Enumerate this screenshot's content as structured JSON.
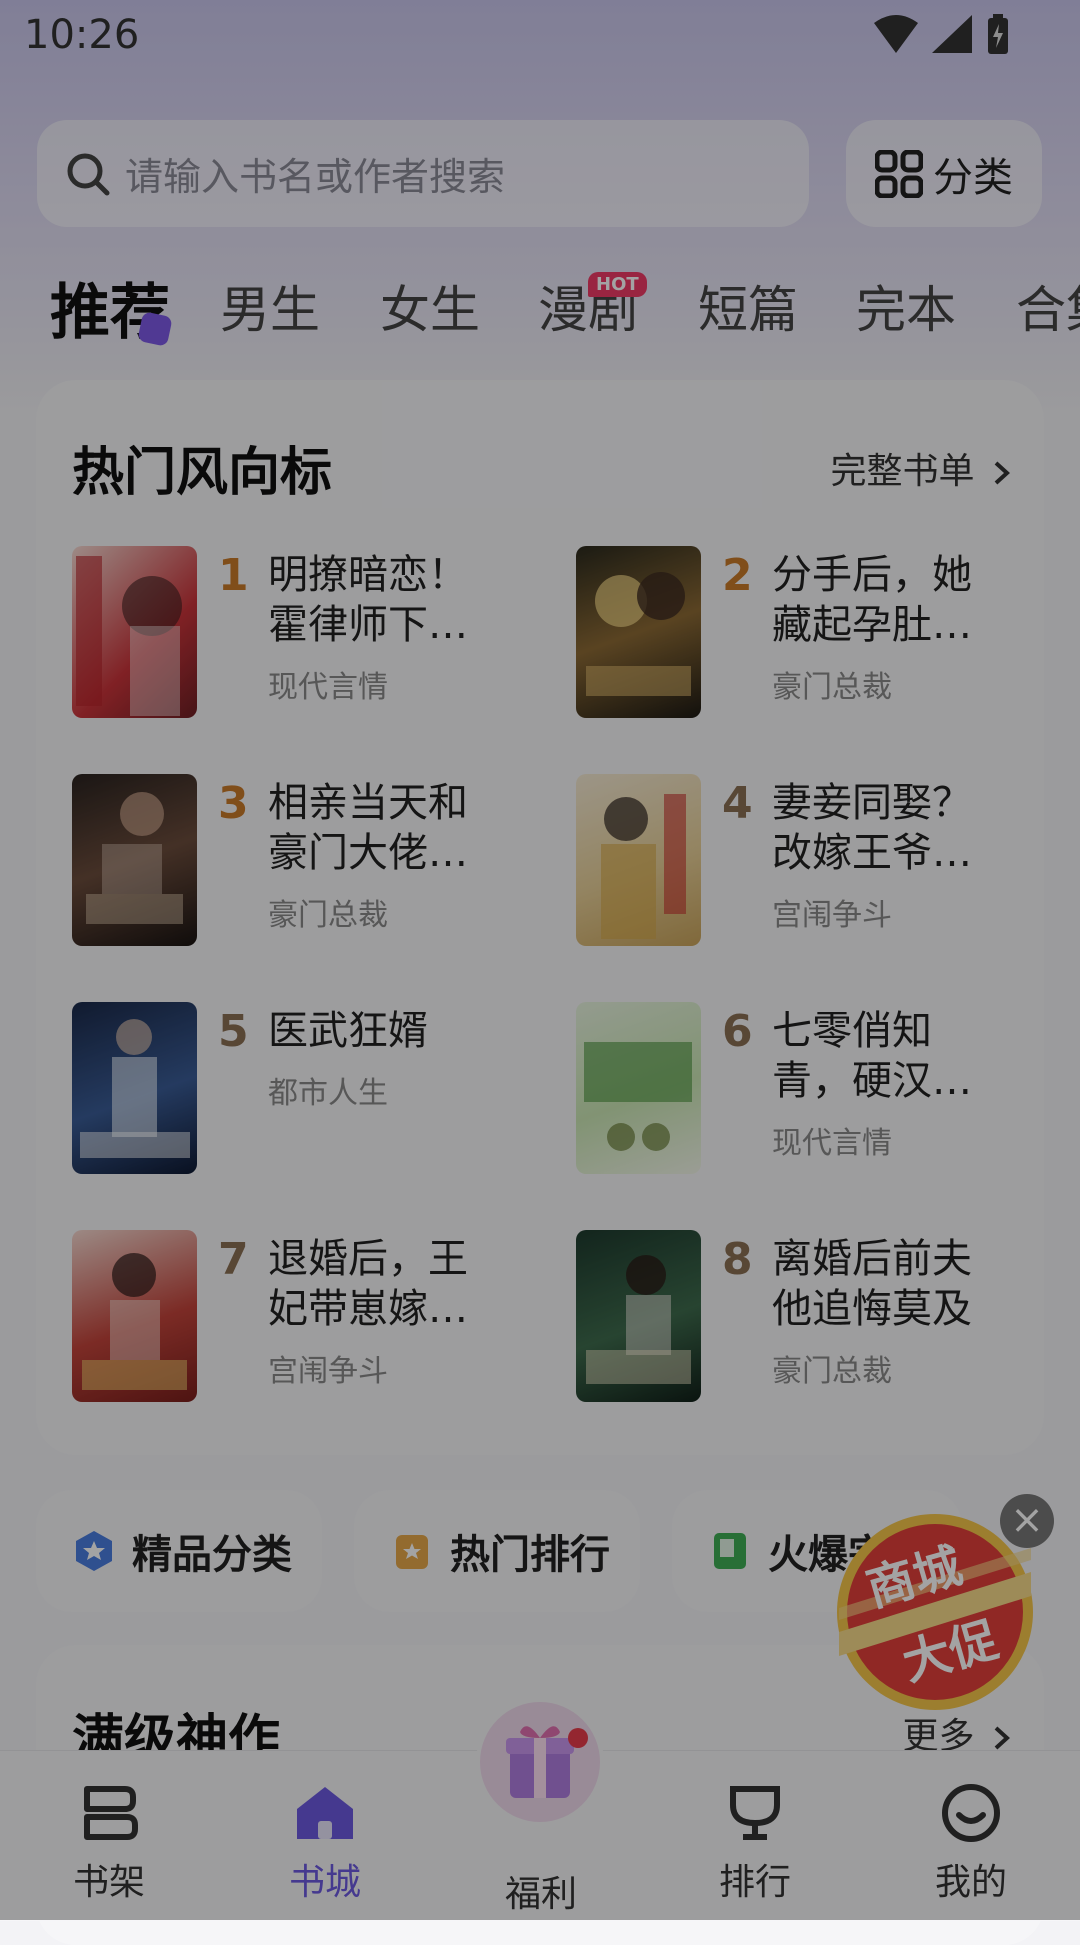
{
  "status": {
    "time": "10:26"
  },
  "search": {
    "placeholder": "请输入书名或作者搜索"
  },
  "category_button": {
    "label": "分类"
  },
  "tabs": [
    {
      "label": "推荐",
      "active": true
    },
    {
      "label": "男生"
    },
    {
      "label": "女生"
    },
    {
      "label": "漫剧",
      "badge": "HOT"
    },
    {
      "label": "短篇"
    },
    {
      "label": "完本"
    },
    {
      "label": "合集"
    }
  ],
  "hot_section": {
    "title": "热门风向标",
    "more": "完整书单",
    "books": [
      {
        "rank": "1",
        "title": "明撩暗恋！霍律师下…",
        "genre": "现代言情"
      },
      {
        "rank": "2",
        "title": "分手后，她藏起孕肚…",
        "genre": "豪门总裁"
      },
      {
        "rank": "3",
        "title": "相亲当天和豪门大佬…",
        "genre": "豪门总裁"
      },
      {
        "rank": "4",
        "title": "妻妾同娶？改嫁王爷…",
        "genre": "宫闱争斗"
      },
      {
        "rank": "5",
        "title": "医武狂婿",
        "genre": "都市人生"
      },
      {
        "rank": "6",
        "title": "七零俏知青，硬汉…",
        "genre": "现代言情"
      },
      {
        "rank": "7",
        "title": "退婚后，王妃带崽嫁…",
        "genre": "宫闱争斗"
      },
      {
        "rank": "8",
        "title": "离婚后前夫他追悔莫及",
        "genre": "豪门总裁"
      }
    ]
  },
  "quick_actions": [
    {
      "label": "精品分类",
      "icon": "star-badge-icon"
    },
    {
      "label": "热门排行",
      "icon": "rank-box-icon"
    },
    {
      "label": "火爆完",
      "icon": "green-book-icon"
    }
  ],
  "promo": {
    "line1": "商城",
    "line2": "大促"
  },
  "section2": {
    "title": "满级神作",
    "more": "更多"
  },
  "bottom_nav": [
    {
      "label": "书架"
    },
    {
      "label": "书城",
      "active": true
    },
    {
      "label": "福利"
    },
    {
      "label": "排行"
    },
    {
      "label": "我的"
    }
  ],
  "colors": {
    "accent": "#6c5ae0",
    "rank_top": "#c87a2a",
    "rank_other": "#8a6f54"
  }
}
